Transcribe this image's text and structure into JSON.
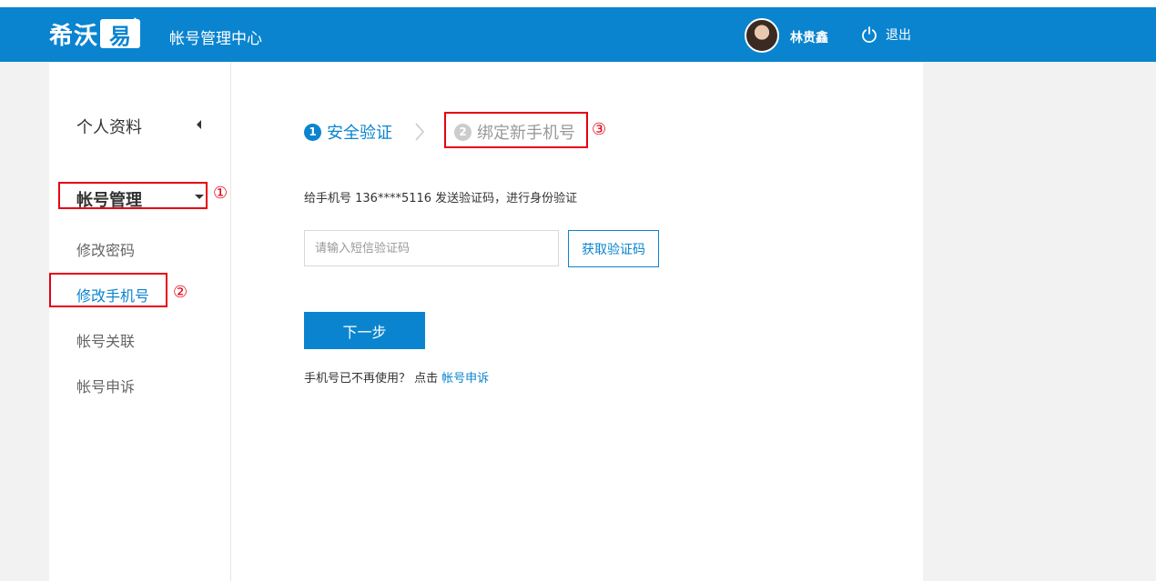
{
  "header": {
    "logo_text": "希沃",
    "logo_box": "易",
    "logo_plus": "+",
    "title": "帐号管理中心",
    "username": "林贵鑫",
    "logout_label": "退出"
  },
  "sidebar": {
    "personal": "个人资料",
    "account": "帐号管理",
    "items": [
      {
        "label": "修改密码"
      },
      {
        "label": "修改手机号"
      },
      {
        "label": "帐号关联"
      },
      {
        "label": "帐号申诉"
      }
    ]
  },
  "annotations": {
    "one": "①",
    "two": "②",
    "three": "③"
  },
  "steps": {
    "step1_num": "1",
    "step1_label": "安全验证",
    "step2_num": "2",
    "step2_label": "绑定新手机号"
  },
  "form": {
    "description": "给手机号 136****5116 发送验证码，进行身份验证",
    "code_placeholder": "请输入短信验证码",
    "get_code_label": "获取验证码",
    "next_label": "下一步",
    "appeal_text": "手机号已不再使用？ 点击",
    "appeal_link": "帐号申诉"
  },
  "colors": {
    "brand": "#0a84cf",
    "annotation": "#e60012"
  }
}
